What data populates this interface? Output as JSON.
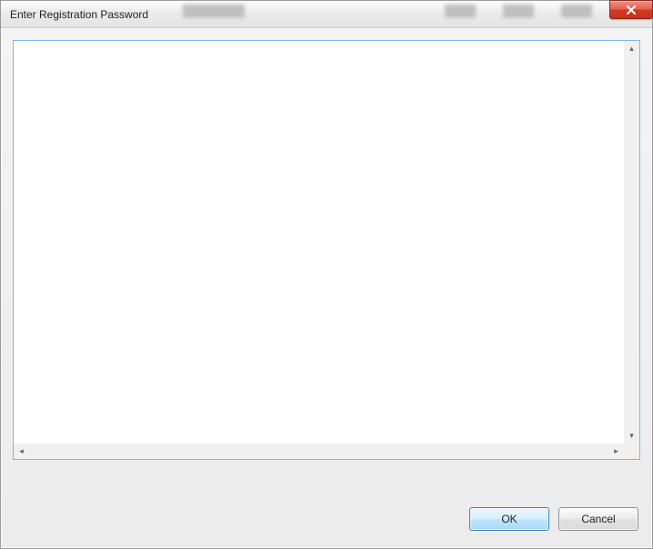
{
  "window": {
    "title": "Enter Registration Password"
  },
  "textarea": {
    "value": ""
  },
  "buttons": {
    "ok": "OK",
    "cancel": "Cancel"
  }
}
